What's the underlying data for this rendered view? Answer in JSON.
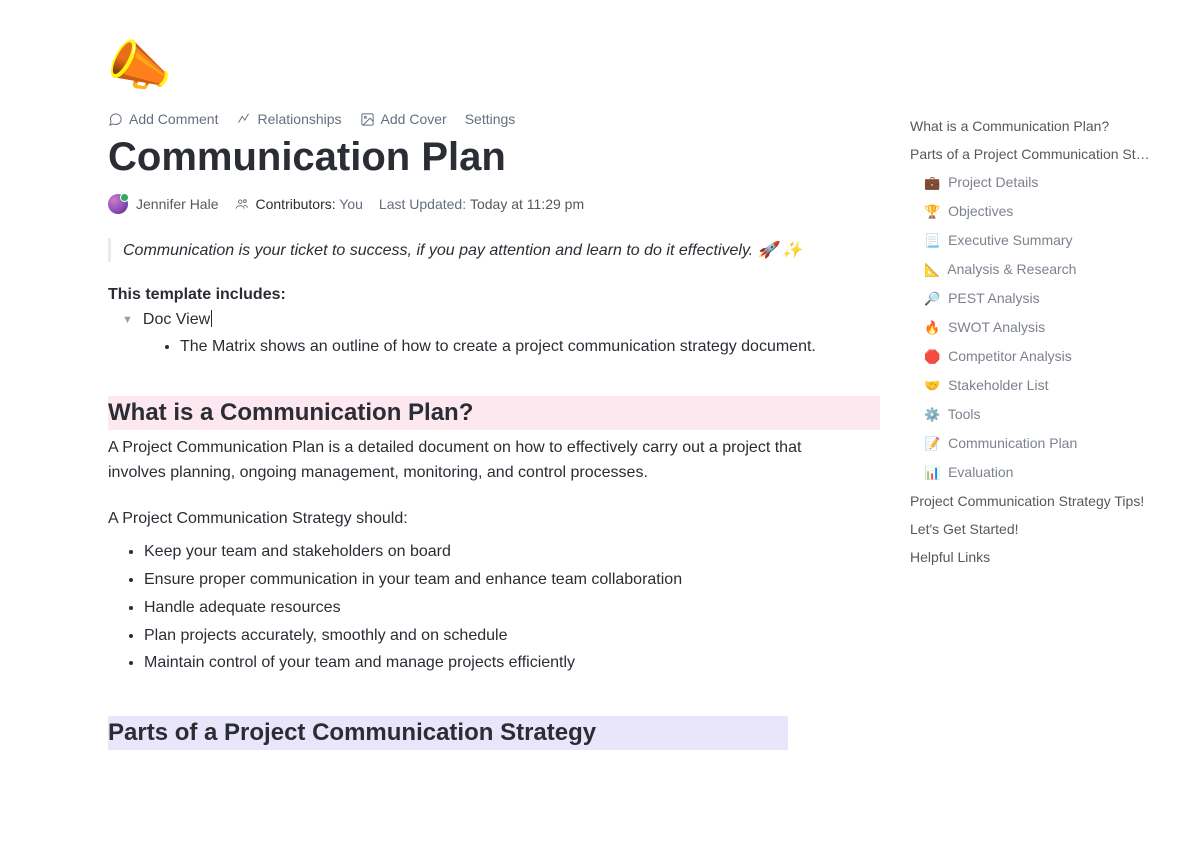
{
  "toolbar": {
    "add_comment": "Add Comment",
    "relationships": "Relationships",
    "add_cover": "Add Cover",
    "settings": "Settings"
  },
  "title": "Communication Plan",
  "meta": {
    "author": "Jennifer Hale",
    "contributors_label": "Contributors:",
    "contributors_value": "You",
    "updated_label": "Last Updated:",
    "updated_value": "Today at 11:29 pm"
  },
  "quote": "Communication is your ticket to success, if you pay attention and learn to do it effectively. 🚀 ✨",
  "includes": {
    "heading": "This template includes:",
    "doc_view": "Doc View",
    "matrix_desc": "The Matrix shows an outline of how to create a project communication strategy document."
  },
  "section1": {
    "heading": "What is a Communication Plan?",
    "p1": "A Project Communication Plan is a detailed document on how to effectively carry out a project that involves planning, ongoing management, monitoring, and control processes.",
    "p2": "A Project Communication Strategy should:",
    "bullets": [
      "Keep your team and stakeholders on board",
      "Ensure proper communication in your team and enhance team collaboration",
      "Handle adequate resources",
      "Plan projects accurately, smoothly and on schedule",
      "Maintain control of your team and manage projects efficiently"
    ]
  },
  "section2": {
    "heading": "Parts of a Project Communication Strategy"
  },
  "toc": {
    "top": [
      "What is a Communication Plan?",
      "Parts of a Project Communication Strategy"
    ],
    "sub": [
      {
        "emoji": "💼",
        "label": "Project Details"
      },
      {
        "emoji": "🏆",
        "label": "Objectives"
      },
      {
        "emoji": "📃",
        "label": "Executive Summary"
      },
      {
        "emoji": "📐",
        "label": "Analysis & Research"
      },
      {
        "emoji": "🔎",
        "label": "PEST Analysis"
      },
      {
        "emoji": "🔥",
        "label": "SWOT Analysis"
      },
      {
        "emoji": "🛑",
        "label": "Competitor Analysis"
      },
      {
        "emoji": "🤝",
        "label": "Stakeholder List"
      },
      {
        "emoji": "⚙️",
        "label": "Tools"
      },
      {
        "emoji": "📝",
        "label": "Communication Plan"
      },
      {
        "emoji": "📊",
        "label": "Evaluation"
      }
    ],
    "bottom": [
      "Project Communication Strategy Tips!",
      "Let's Get Started!",
      "Helpful Links"
    ]
  }
}
